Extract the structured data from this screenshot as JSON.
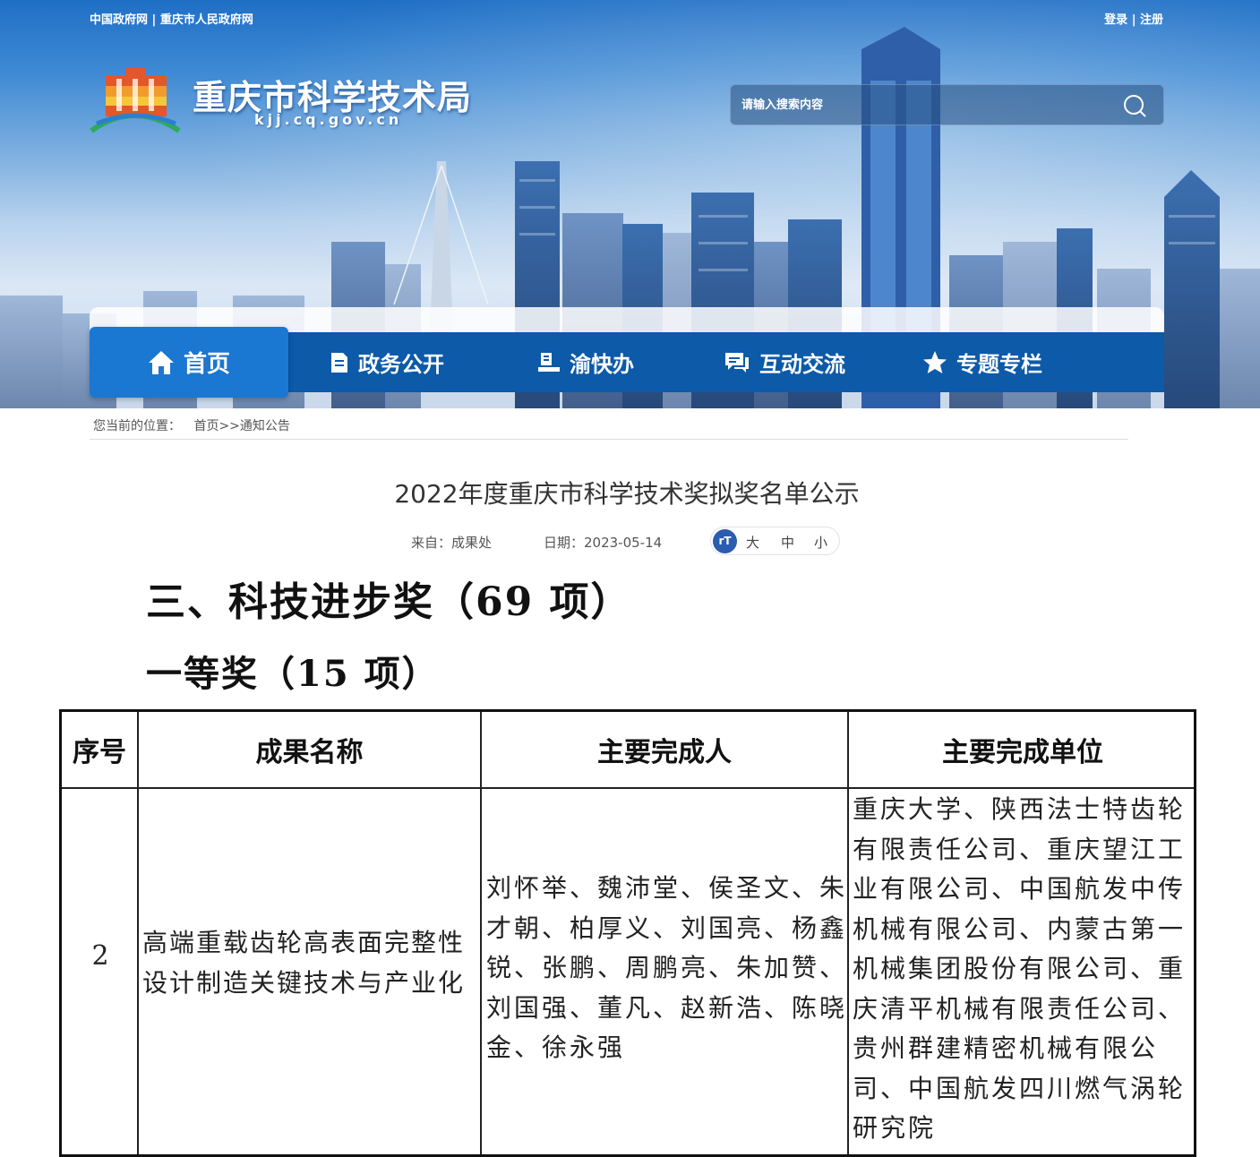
{
  "header": {
    "gov_links": [
      "中国政府网",
      "重庆市人民政府网"
    ],
    "separator": "|",
    "login_label": "登录",
    "register_label": "注册",
    "site_title": "重庆市科学技术局",
    "site_domain": "kjj.cq.gov.cn",
    "search_placeholder": "请输入搜索内容"
  },
  "nav": {
    "items": [
      {
        "label": "首页",
        "icon": "home-icon",
        "active": true
      },
      {
        "label": "政务公开",
        "icon": "document-icon",
        "active": false
      },
      {
        "label": "渝快办",
        "icon": "desk-icon",
        "active": false
      },
      {
        "label": "互动交流",
        "icon": "chat-icon",
        "active": false
      },
      {
        "label": "专题专栏",
        "icon": "star-icon",
        "active": false
      }
    ]
  },
  "breadcrumb": {
    "prefix": "您当前的位置：",
    "home": "首页",
    "arrow": ">>",
    "current": "通知公告"
  },
  "article": {
    "title": "2022年度重庆市科学技术奖拟奖名单公示",
    "source": "来自：成果处",
    "date": "日期：2023-05-14",
    "font_icon_text": "rT",
    "font_sizes": [
      "大",
      "中",
      "小"
    ]
  },
  "document": {
    "heading1": "三、科技进步奖（69 项）",
    "heading2": "一等奖（15 项）",
    "columns": [
      "序号",
      "成果名称",
      "主要完成人",
      "主要完成单位"
    ],
    "row": {
      "index": "2",
      "name": "高端重载齿轮高表面完整性设计制造关键技术与产业化",
      "people": "刘怀举、魏沛堂、侯圣文、朱才朝、柏厚义、刘国亮、杨鑫锐、张鹏、周鹏亮、朱加赞、刘国强、董凡、赵新浩、陈晓金、徐永强",
      "units": "重庆大学、陕西法士特齿轮有限责任公司、重庆望江工业有限公司、中国航发中传机械有限公司、内蒙古第一机械集团股份有限公司、重庆清平机械有限责任公司、贵州群建精密机械有限公司、中国航发四川燃气涡轮研究院"
    }
  },
  "colors": {
    "nav_bg": "#0c5aa8",
    "nav_active": "#1a77d2",
    "sky_top": "#1f6fc6"
  }
}
